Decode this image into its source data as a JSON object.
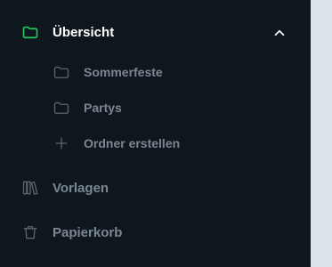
{
  "nav": {
    "overview": {
      "label": "Übersicht",
      "icon": "folder-icon",
      "expanded": true
    },
    "folders": [
      {
        "label": "Sommerfeste",
        "icon": "folder-icon"
      },
      {
        "label": "Partys",
        "icon": "folder-icon"
      }
    ],
    "create_folder": {
      "label": "Ordner erstellen",
      "icon": "plus-icon"
    },
    "templates": {
      "label": "Vorlagen",
      "icon": "library-icon"
    },
    "trash": {
      "label": "Papierkorb",
      "icon": "trash-icon"
    }
  },
  "colors": {
    "sidebar_bg": "#0e171e",
    "accent_green": "#22c55e",
    "text_active": "#ffffff",
    "text_muted": "#7c8791",
    "icon_muted": "#5a646d",
    "content_bg": "#dde3ea"
  }
}
